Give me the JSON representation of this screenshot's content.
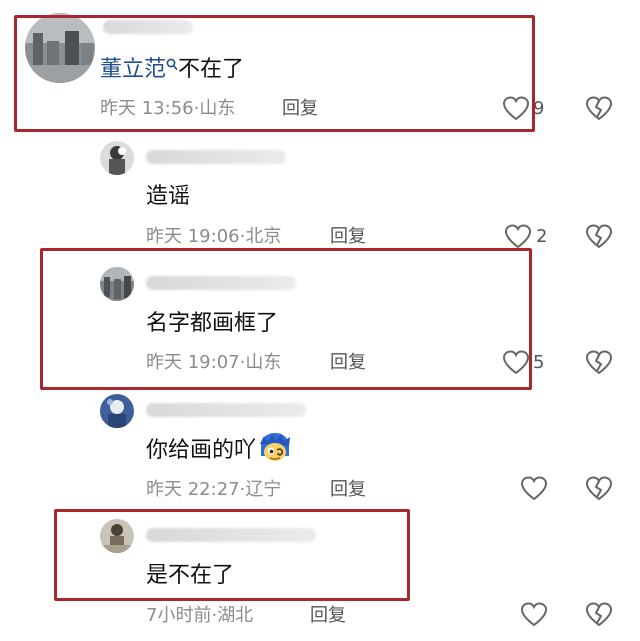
{
  "comments": [
    {
      "author_blurred": true,
      "mention": "董立范",
      "text": "不在了",
      "time": "昨天 13:56",
      "location": "山东",
      "reply_label": "回复",
      "like_count": "9"
    },
    {
      "author_blurred": true,
      "text": "造谣",
      "time": "昨天 19:06",
      "location": "北京",
      "reply_label": "回复",
      "like_count": "2"
    },
    {
      "author_blurred": true,
      "text": "名字都画框了",
      "time": "昨天 19:07",
      "location": "山东",
      "reply_label": "回复",
      "like_count": "5"
    },
    {
      "author_blurred": true,
      "text": "你给画的吖",
      "emoji_icon": "blue-hair-character-emoji",
      "time": "昨天 22:27",
      "location": "辽宁",
      "reply_label": "回复",
      "like_count": ""
    },
    {
      "author_blurred": true,
      "text": "是不在了",
      "time": "7小时前",
      "location": "湖北",
      "reply_label": "回复",
      "like_count": ""
    }
  ],
  "meta_separator": "·",
  "colors": {
    "highlight_frame": "#a9272d",
    "mention": "#1d4f8f",
    "meta": "#8c8c8c"
  },
  "icons": {
    "like": "heart-outline-icon",
    "dislike": "broken-heart-icon",
    "mention_marker": "search-icon"
  }
}
